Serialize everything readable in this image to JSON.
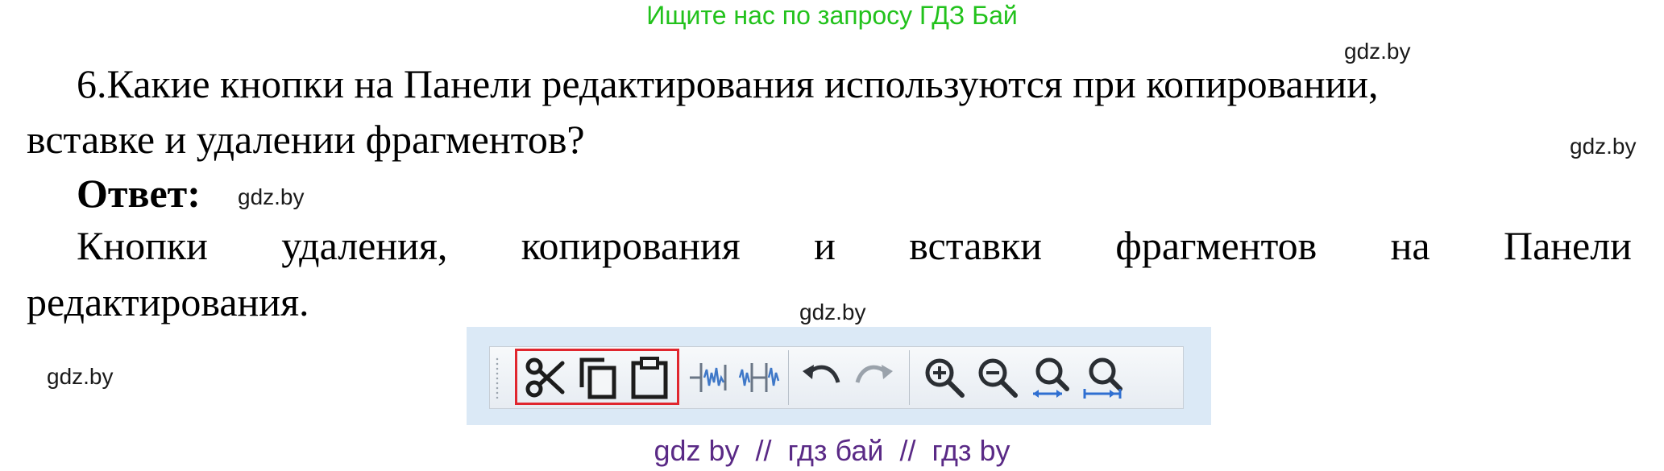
{
  "banner": "Ищите нас по запросу ГДЗ Бай",
  "watermarks": [
    "gdz.by",
    "gdz.by",
    "gdz.by",
    "gdz.by",
    "gdz.by"
  ],
  "question": {
    "line1": "6.Какие кнопки на Панели редактирования используются при копировании,",
    "line2": "вставке и удалении фрагментов?"
  },
  "answer": {
    "label": "Ответ:",
    "line1_words": [
      "Кнопки",
      "удаления,",
      "копирования",
      "и",
      "вставки",
      "фрагментов",
      "на",
      "Панели"
    ],
    "line2": "редактирования."
  },
  "toolbar": {
    "buttons": [
      {
        "icon": "scissors-icon",
        "action": "cut"
      },
      {
        "icon": "copy-icon",
        "action": "copy"
      },
      {
        "icon": "paste-icon",
        "action": "paste"
      },
      {
        "icon": "trim-left-icon",
        "action": "trim"
      },
      {
        "icon": "silence-icon",
        "action": "silence"
      },
      {
        "icon": "undo-icon",
        "action": "undo"
      },
      {
        "icon": "redo-icon",
        "action": "redo"
      },
      {
        "icon": "zoom-in-icon",
        "action": "zoom-in"
      },
      {
        "icon": "zoom-out-icon",
        "action": "zoom-out"
      },
      {
        "icon": "fit-selection-icon",
        "action": "fit-selection"
      },
      {
        "icon": "fit-project-icon",
        "action": "fit-project"
      }
    ],
    "highlight_color": "#e0262e",
    "background_color": "#dbe9f6"
  },
  "footer": "gdz by  //  гдз бай  //  гдз by",
  "colors": {
    "banner": "#22c21c",
    "footer": "#5a2a86"
  }
}
